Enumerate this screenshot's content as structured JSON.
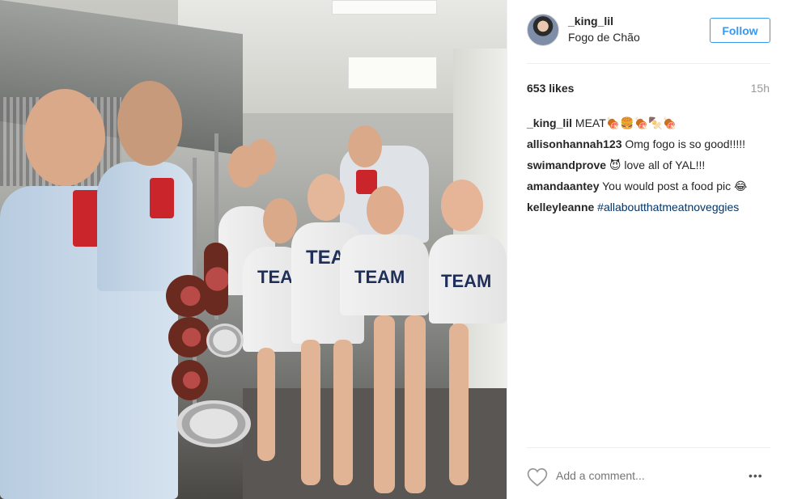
{
  "post": {
    "photo_icon": "photo-content",
    "header": {
      "username": "_king_lil",
      "location": "Fogo de Chão",
      "follow_label": "Follow",
      "avatar_icon": "profile-avatar"
    },
    "likes": "653 likes",
    "timestamp": "15h",
    "comments": [
      {
        "user": "_king_lil",
        "text": "MEAT🍖🍔🍖🍢🍖"
      },
      {
        "user": "allisonhannah123",
        "text": "Omg fogo is so good!!!!!"
      },
      {
        "user": "swimandprove",
        "text": "😈 love all of YAL!!!"
      },
      {
        "user": "amandaantey",
        "text": "You would post a food pic 😂"
      },
      {
        "user": "kelleyleanne",
        "text": "#allaboutthatmeatnoveggies"
      }
    ],
    "add_comment_placeholder": "Add a comment...",
    "more_label": "•••",
    "colors": {
      "accent": "#3897f0",
      "hashtag": "#003569",
      "muted": "#999999"
    }
  }
}
